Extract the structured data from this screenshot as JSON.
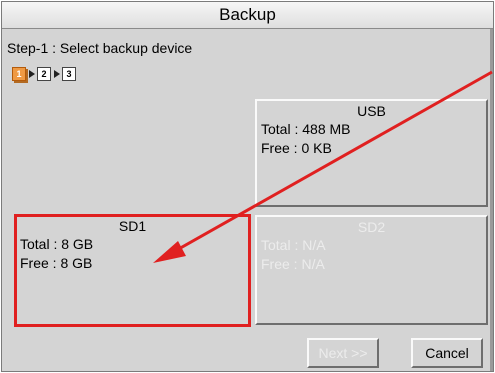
{
  "window": {
    "title": "Backup"
  },
  "step": {
    "label": "Step-1 : Select backup device",
    "indicators": [
      "1",
      "2",
      "3"
    ],
    "active": 1
  },
  "devices": {
    "usb": {
      "name": "USB",
      "total": "Total : 488 MB",
      "free": "Free  : 0 KB",
      "enabled": true
    },
    "sd1": {
      "name": "SD1",
      "total": "Total : 8 GB",
      "free": "Free  : 8 GB",
      "enabled": true,
      "selected": true
    },
    "sd2": {
      "name": "SD2",
      "total": "Total : N/A",
      "free": "Free  : N/A",
      "enabled": false
    }
  },
  "buttons": {
    "next_label": "Next >>",
    "cancel_label": "Cancel"
  },
  "colors": {
    "highlight": "#e02020",
    "active_step": "#ef9a44",
    "disabled_text": "#ececec"
  }
}
